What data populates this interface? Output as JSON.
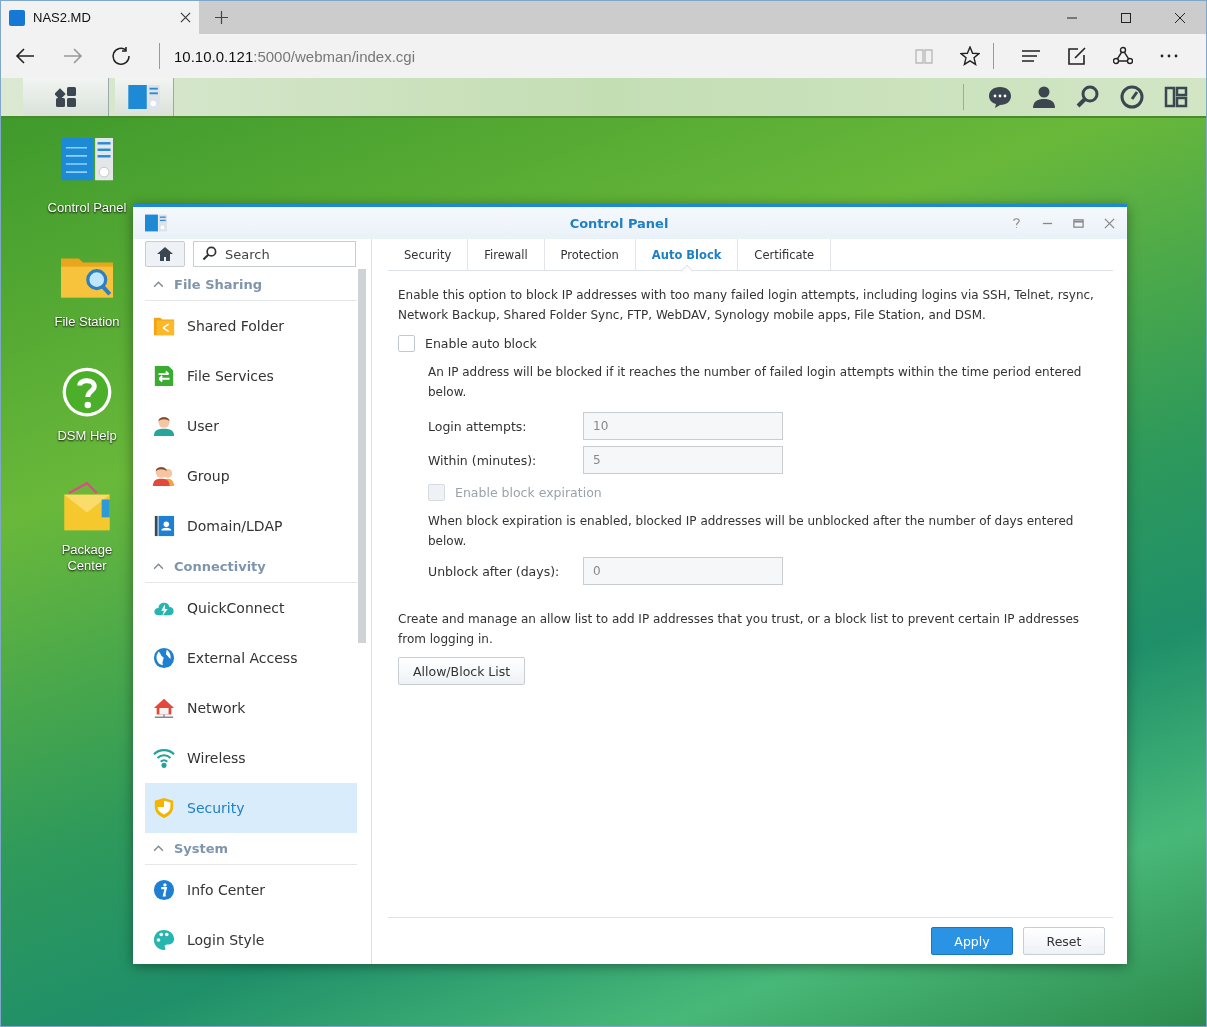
{
  "browser": {
    "tab_title": "NAS2.MD",
    "url_host": "10.10.0.121",
    "url_rest": ":5000/webman/index.cgi"
  },
  "desktop_icons": [
    {
      "label": "Control Panel"
    },
    {
      "label": "File Station"
    },
    {
      "label": "DSM Help"
    },
    {
      "label": "Package Center"
    }
  ],
  "window": {
    "title": "Control Panel"
  },
  "sidebar": {
    "search": {
      "placeholder": "Search"
    },
    "sections": [
      {
        "title": "File Sharing",
        "expanded": true,
        "items": [
          {
            "label": "Shared Folder",
            "selected": false
          },
          {
            "label": "File Services",
            "selected": false
          },
          {
            "label": "User",
            "selected": false
          },
          {
            "label": "Group",
            "selected": false
          },
          {
            "label": "Domain/LDAP",
            "selected": false
          }
        ]
      },
      {
        "title": "Connectivity",
        "expanded": true,
        "items": [
          {
            "label": "QuickConnect",
            "selected": false
          },
          {
            "label": "External Access",
            "selected": false
          },
          {
            "label": "Network",
            "selected": false
          },
          {
            "label": "Wireless",
            "selected": false
          },
          {
            "label": "Security",
            "selected": true
          }
        ]
      },
      {
        "title": "System",
        "expanded": true,
        "items": [
          {
            "label": "Info Center",
            "selected": false
          },
          {
            "label": "Login Style",
            "selected": false
          }
        ]
      }
    ]
  },
  "tabs": [
    {
      "label": "Security",
      "selected": false
    },
    {
      "label": "Firewall",
      "selected": false
    },
    {
      "label": "Protection",
      "selected": false
    },
    {
      "label": "Auto Block",
      "selected": true
    },
    {
      "label": "Certificate",
      "selected": false
    }
  ],
  "intro": "Enable this option to block IP addresses with too many failed login attempts, including logins via SSH, Telnet, rsync, Network Backup, Shared Folder Sync, FTP, WebDAV, Synology mobile apps, File Station, and DSM.",
  "enable_auto_block": {
    "label": "Enable auto block",
    "checked": false,
    "disabled": false
  },
  "block_note": "An IP address will be blocked if it reaches the number of failed login attempts within the time period entered below.",
  "fields": [
    {
      "label": "Login attempts:",
      "value": "10",
      "disabled": true
    },
    {
      "label": "Within (minutes):",
      "value": "5",
      "disabled": true
    }
  ],
  "enable_expiration": {
    "label": "Enable block expiration",
    "checked": false,
    "disabled": true
  },
  "expiration_note": "When block expiration is enabled, blocked IP addresses will be unblocked after the number of days entered below.",
  "expiration_fields": [
    {
      "label": "Unblock after (days):",
      "value": "0",
      "disabled": true
    }
  ],
  "list_note": "Create and manage an allow list to add IP addresses that you trust, or a block list to prevent certain IP addresses from logging in.",
  "list_button": "Allow/Block List",
  "footer_buttons": [
    {
      "label": "Apply",
      "kind": "primary"
    },
    {
      "label": "Reset",
      "kind": "secondary"
    }
  ]
}
